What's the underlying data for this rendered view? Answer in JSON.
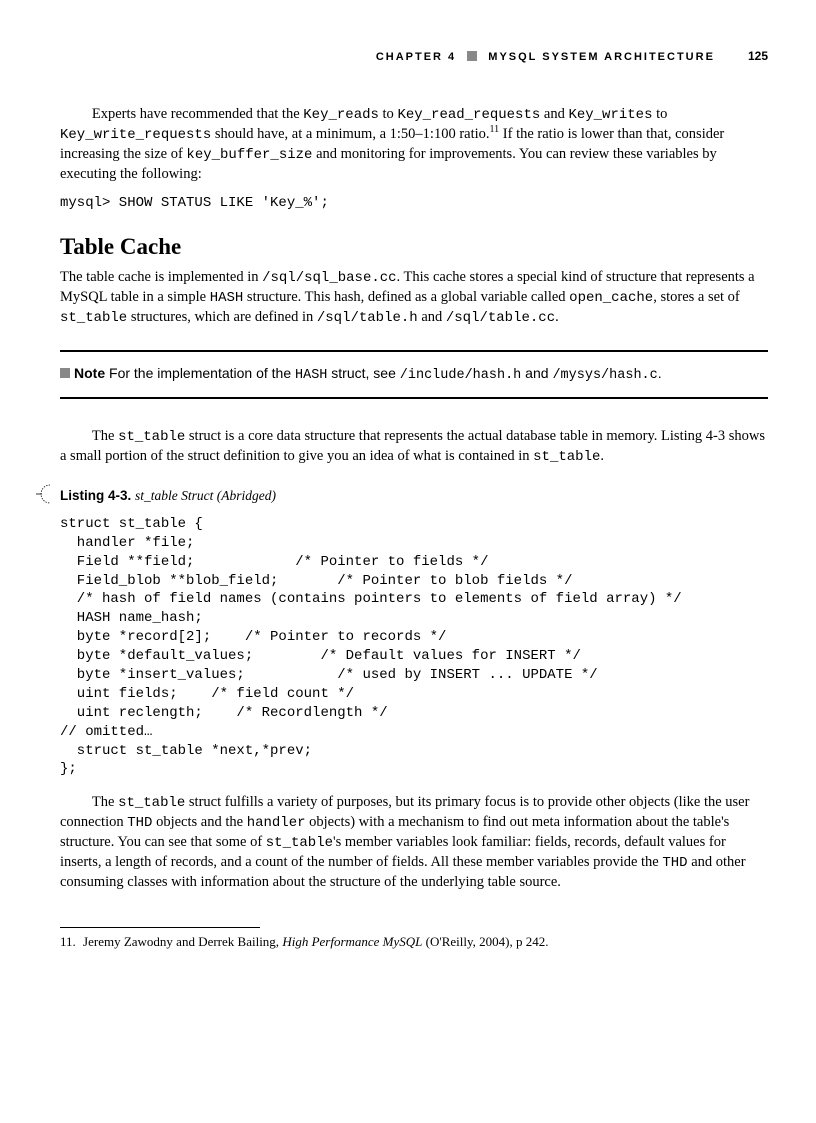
{
  "header": {
    "chapter_label": "CHAPTER 4",
    "chapter_title": "MYSQL SYSTEM ARCHITECTURE",
    "page_number": "125"
  },
  "para1": {
    "t1": "Experts have recommended that the ",
    "c1": "Key_reads",
    "t2": " to ",
    "c2": "Key_read_requests",
    "t3": " and ",
    "c3": "Key_writes",
    "t4": " to ",
    "c4": "Key_write_requests",
    "t5": " should have, at a minimum, a 1:50–1:100 ratio.",
    "sup": "11",
    "t6": " If the ratio is lower than that, consider increasing the size of ",
    "c5": "key_buffer_size",
    "t7": " and monitoring for improvements. You can review these variables by executing the following:"
  },
  "cmd": "mysql> SHOW STATUS LIKE 'Key_%';",
  "section_title": "Table Cache",
  "para2": {
    "t1": "The table cache is implemented in ",
    "c1": "/sql/sql_base.cc",
    "t2": ". This cache stores a special kind of structure that represents a MySQL table in a simple ",
    "c2": "HASH",
    "t3": " structure. This hash, defined as a global variable called ",
    "c3": "open_cache",
    "t4": ", stores a set of ",
    "c4": "st_table",
    "t5": " structures, which are defined in ",
    "c5": "/sql/table.h",
    "t6": " and ",
    "c6": "/sql/table.cc",
    "t7": "."
  },
  "note": {
    "label": "Note",
    "t1": " For the implementation of the ",
    "c1": "HASH",
    "t2": " struct, see ",
    "c2": "/include/hash.h",
    "t3": " and ",
    "c3": "/mysys/hash.c",
    "t4": "."
  },
  "para3": {
    "t1": "The ",
    "c1": "st_table",
    "t2": " struct is a core data structure that represents the actual database table in memory. Listing 4-3 shows a small portion of the struct definition to give you an idea of what is contained in ",
    "c2": "st_table",
    "t3": "."
  },
  "listing": {
    "label": "Listing 4-3.",
    "caption_italic": "st_table Struct (Abridged)"
  },
  "code": "struct st_table {\n  handler *file;\n  Field **field;            /* Pointer to fields */\n  Field_blob **blob_field;       /* Pointer to blob fields */\n  /* hash of field names (contains pointers to elements of field array) */\n  HASH name_hash;\n  byte *record[2];    /* Pointer to records */\n  byte *default_values;        /* Default values for INSERT */\n  byte *insert_values;           /* used by INSERT ... UPDATE */\n  uint fields;    /* field count */\n  uint reclength;    /* Recordlength */\n// omitted…\n  struct st_table *next,*prev;\n};",
  "para4": {
    "t1": "The ",
    "c1": "st_table",
    "t2": " struct fulfills a variety of purposes, but its primary focus is to provide other objects (like the user connection ",
    "c2": "THD",
    "t3": " objects and the ",
    "c3": "handler",
    "t4": " objects) with a mechanism to find out meta information about the table's structure. You can see that some of ",
    "c4": "st_table",
    "t5": "'s member variables look familiar: fields, records, default values for inserts, a length of records, and a count of the number of fields. All these member variables provide the ",
    "c5": "THD",
    "t6": " and other consuming classes with information about the structure of the underlying table source."
  },
  "footnote": {
    "num": "11.",
    "t1": "Jeremy Zawodny and Derrek Bailing, ",
    "em": "High Performance MySQL",
    "t2": " (O'Reilly, 2004), p 242."
  }
}
